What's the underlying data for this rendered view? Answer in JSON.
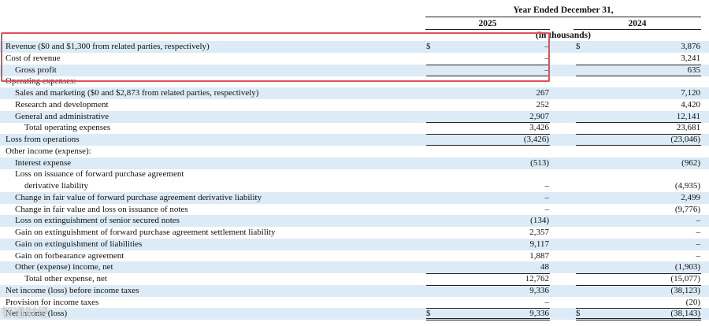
{
  "header": {
    "period_caption": "Year Ended December 31,",
    "col_2025": "2025",
    "col_2024": "2024",
    "units": "(in thousands)"
  },
  "currency_symbol": "$",
  "rows": [
    {
      "label": "Revenue ($0 and $1,300 from related parties, respectively)",
      "indent": 0,
      "v2025": "–",
      "v2024": "3,876",
      "currency": true,
      "shade": true
    },
    {
      "label": "Cost of revenue",
      "indent": 0,
      "v2025": "–",
      "v2024": "3,241",
      "shade": false
    },
    {
      "label": "Gross profit",
      "indent": 1,
      "v2025": "–",
      "v2024": "635",
      "shade": true,
      "line_above": true,
      "line_below": true
    },
    {
      "label": "Operating expenses:",
      "indent": 0,
      "v2025": "",
      "v2024": "",
      "shade": false
    },
    {
      "label": "Sales and marketing ($0 and $2,873 from related parties, respectively)",
      "indent": 1,
      "v2025": "267",
      "v2024": "7,120",
      "shade": true
    },
    {
      "label": "Research and development",
      "indent": 1,
      "v2025": "252",
      "v2024": "4,420",
      "shade": false
    },
    {
      "label": "General and administrative",
      "indent": 1,
      "v2025": "2,907",
      "v2024": "12,141",
      "shade": true
    },
    {
      "label": "Total operating expenses",
      "indent": 2,
      "v2025": "3,426",
      "v2024": "23,681",
      "shade": false,
      "line_above": true
    },
    {
      "label": "Loss from operations",
      "indent": 0,
      "v2025": "(3,426)",
      "v2024": "(23,046)",
      "shade": true,
      "line_above": true,
      "line_below": true
    },
    {
      "label": "Other income (expense):",
      "indent": 0,
      "v2025": "",
      "v2024": "",
      "shade": false
    },
    {
      "label": "Interest expense",
      "indent": 1,
      "v2025": "(513)",
      "v2024": "(962)",
      "shade": true
    },
    {
      "label": "Loss on issuance of forward purchase agreement",
      "indent": 1,
      "v2025": "",
      "v2024": "",
      "shade": false
    },
    {
      "label": "derivative liability",
      "indent": 2,
      "v2025": "–",
      "v2024": "(4,935)",
      "shade": false
    },
    {
      "label": "Change in fair value of forward purchase agreement derivative liability",
      "indent": 1,
      "v2025": "–",
      "v2024": "2,499",
      "shade": true
    },
    {
      "label": "Change in fair value and loss on issuance of notes",
      "indent": 1,
      "v2025": "–",
      "v2024": "(9,776)",
      "shade": false
    },
    {
      "label": "Loss on extinguishment of senior secured notes",
      "indent": 1,
      "v2025": "(134)",
      "v2024": "–",
      "shade": true
    },
    {
      "label": "Gain on extinguishment of forward purchase agreement settlement liability",
      "indent": 1,
      "v2025": "2,357",
      "v2024": "–",
      "shade": false
    },
    {
      "label": "Gain on extinguishment of liabilities",
      "indent": 1,
      "v2025": "9,117",
      "v2024": "–",
      "shade": true
    },
    {
      "label": "Gain on forbearance agreement",
      "indent": 1,
      "v2025": "1,887",
      "v2024": "–",
      "shade": false
    },
    {
      "label": "Other (expense) income, net",
      "indent": 1,
      "v2025": "48",
      "v2024": "(1,903)",
      "shade": true
    },
    {
      "label": "Total other expense, net",
      "indent": 2,
      "v2025": "12,762",
      "v2024": "(15,077)",
      "shade": false,
      "line_above": true
    },
    {
      "label": "Net income (loss) before income taxes",
      "indent": 0,
      "v2025": "9,336",
      "v2024": "(38,123)",
      "shade": true,
      "line_above": true
    },
    {
      "label": "Provision for income taxes",
      "indent": 0,
      "v2025": "–",
      "v2024": "(20)",
      "shade": false
    },
    {
      "label": "Net income (loss)",
      "indent": 0,
      "v2025": "9,336",
      "v2024": "(38,143)",
      "currency": true,
      "shade": true,
      "line_above": true,
      "double_below": true
    }
  ],
  "watermark": "智通财经",
  "colors": {
    "row_shade": "#dcebf6",
    "highlight_border": "#e0515a",
    "rule": "#222222"
  }
}
